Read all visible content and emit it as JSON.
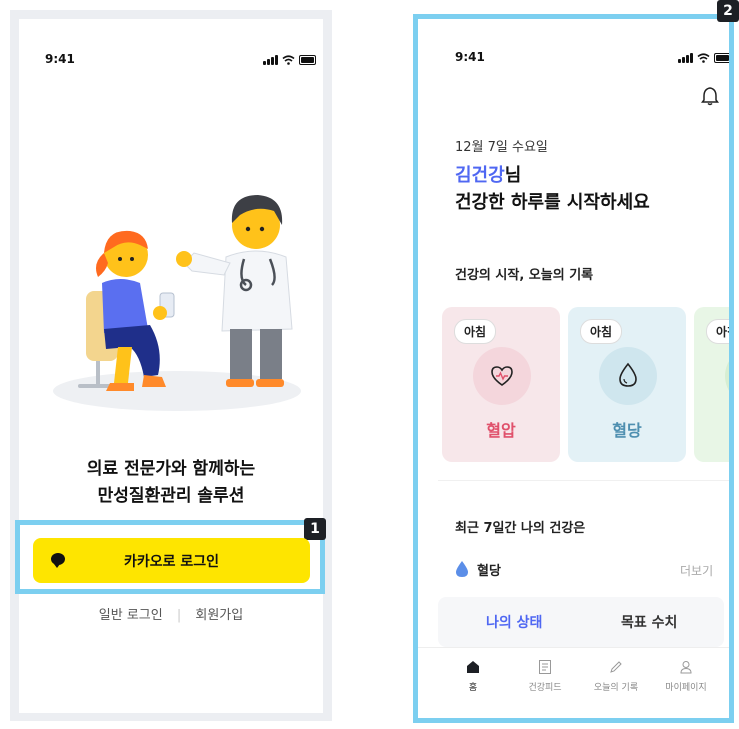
{
  "screen1": {
    "status_time": "9:41",
    "headline_line1": "의료 전문가와 함께하는",
    "headline_line2": "만성질환관리 솔루션",
    "kakao_login_label": "카카오로 로그인",
    "general_login_label": "일반 로그인",
    "separator": "|",
    "signup_label": "회원가입",
    "badge_number": "1"
  },
  "screen2": {
    "badge_number": "2",
    "status_time": "9:41",
    "date": "12월 7일 수요일",
    "user_name": "김건강",
    "name_suffix": "님",
    "greeting": "건강한 하루를 시작하세요",
    "record_section_title": "건강의 시작, 오늘의 기록",
    "cards": [
      {
        "pill": "아침",
        "label": "혈압",
        "bg": "#f7e7ea",
        "circle": "#f4d6dc",
        "color": "#e0516b"
      },
      {
        "pill": "아침",
        "label": "혈당",
        "bg": "#e3f1f6",
        "circle": "#cfe6ee",
        "color": "#4e8fb0"
      },
      {
        "pill": "아침",
        "label": "",
        "bg": "#e8f6e6",
        "circle": "#d6eed3",
        "color": "#3e9f4e"
      }
    ],
    "weekly_section_title": "최근 7일간 나의 건강은",
    "metric_label": "혈당",
    "more_label": "더보기",
    "tab_status": "나의 상태",
    "tab_goal": "목표 수치",
    "nav": {
      "home": "홈",
      "feed": "건강피드",
      "record": "오늘의 기록",
      "mypage": "마이페이지"
    }
  },
  "colors": {
    "kakao_yellow": "#fee500",
    "highlight_blue": "#7ccff0",
    "accent_blue": "#4f67f2"
  }
}
